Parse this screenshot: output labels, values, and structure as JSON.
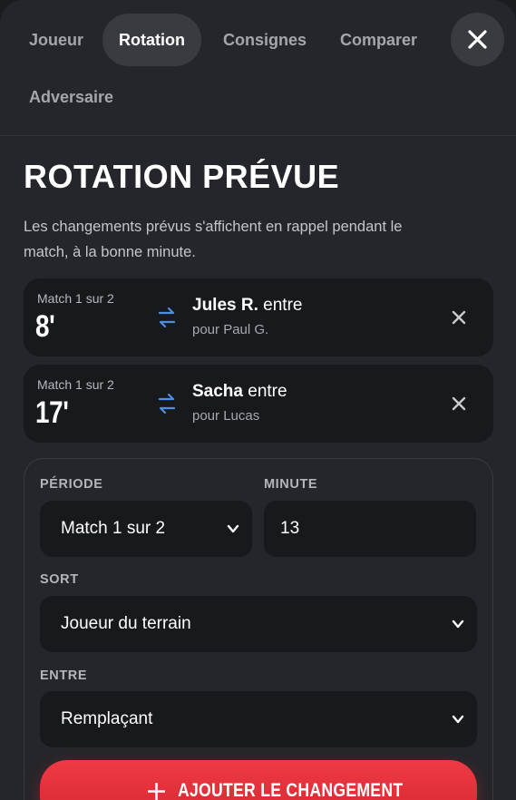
{
  "tabs": [
    {
      "label": "Joueur",
      "active": false
    },
    {
      "label": "Rotation",
      "active": true
    },
    {
      "label": "Consignes",
      "active": false
    },
    {
      "label": "Comparer",
      "active": false
    },
    {
      "label": "Adversaire",
      "active": false
    }
  ],
  "close_icon": "close-icon",
  "page": {
    "title": "ROTATION PRÉVUE",
    "description": "Les changements prévus s'affichent en rappel pendant le match, à la bonne minute."
  },
  "rotations": [
    {
      "period": "Match 1 sur 2",
      "minute": "8'",
      "player_in": "Jules R.",
      "action": "entre",
      "player_out": "pour Paul G."
    },
    {
      "period": "Match 1 sur 2",
      "minute": "17'",
      "player_in": "Sacha",
      "action": "entre",
      "player_out": "pour Lucas"
    }
  ],
  "form": {
    "period_label": "PÉRIODE",
    "period_value": "Match 1 sur 2",
    "minute_label": "MINUTE",
    "minute_value": "13",
    "out_label": "SORT",
    "out_value": "Joueur du terrain",
    "in_label": "ENTRE",
    "in_value": "Remplaçant",
    "submit_label": "AJOUTER LE CHANGEMENT"
  },
  "colors": {
    "background": "#25262b",
    "card": "#18191c",
    "accent_red": "#e3303a",
    "swap_blue": "#4d8fe6"
  }
}
